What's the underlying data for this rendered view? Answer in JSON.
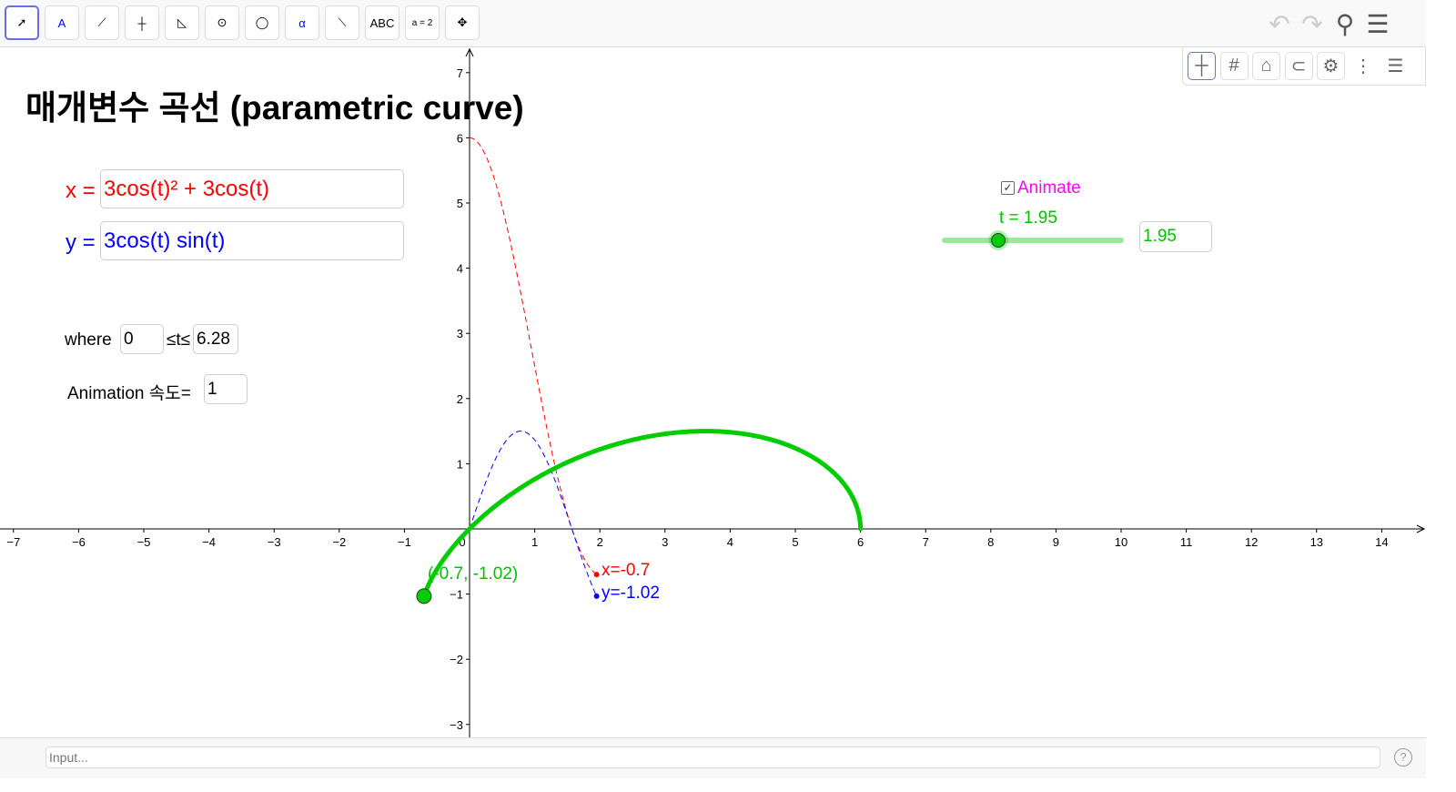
{
  "toolbar": {
    "tools": [
      {
        "name": "move-tool",
        "label": ""
      },
      {
        "name": "point-tool",
        "label": "A"
      },
      {
        "name": "line-tool",
        "label": ""
      },
      {
        "name": "perpendicular-line-tool",
        "label": ""
      },
      {
        "name": "polygon-tool",
        "label": ""
      },
      {
        "name": "circle-center-point-tool",
        "label": ""
      },
      {
        "name": "circle-three-points-tool",
        "label": ""
      },
      {
        "name": "angle-tool",
        "label": "α"
      },
      {
        "name": "reflect-tool",
        "label": ""
      },
      {
        "name": "text-tool",
        "label": "ABC"
      },
      {
        "name": "slider-tool",
        "label": "a = 2"
      },
      {
        "name": "move-graphics-tool",
        "label": ""
      }
    ],
    "right_icons": [
      "undo-icon",
      "redo-icon",
      "search-icon",
      "menu-icon"
    ]
  },
  "graphics_bar": {
    "icons": [
      "axes-icon",
      "grid-icon",
      "home-icon",
      "magnet-icon",
      "gear-icon",
      "more-icon",
      "style-bar-icon"
    ]
  },
  "title": "매개변수 곡선 (parametric curve)",
  "equations": {
    "x_label": "x =",
    "x_value": "3cos(t)² + 3cos(t)",
    "y_label": "y =",
    "y_value": "3cos(t) sin(t)"
  },
  "range": {
    "where_label": "where",
    "min": "0",
    "symbol": "≤t≤",
    "max": "6.28"
  },
  "animation": {
    "label": "Animation 속도=",
    "speed": "1"
  },
  "animate_checkbox": {
    "label": "Animate",
    "checked": true
  },
  "slider": {
    "label": "t = 1.95",
    "value": 1.95,
    "min": 0,
    "max": 6.28,
    "input_value": "1.95"
  },
  "point_label": "(-0.7, -1.02)",
  "x_point_label": "x=-0.7",
  "y_point_label": "y=-1.02",
  "input_bar": {
    "placeholder": "Input..."
  },
  "colors": {
    "x": "#ff0000",
    "y": "#0000ff",
    "curve": "#00cc00",
    "animate": "#ff00ff"
  },
  "axes": {
    "x_ticks": [
      -7,
      -6,
      -5,
      -4,
      -3,
      -2,
      -1,
      0,
      1,
      2,
      3,
      4,
      5,
      6,
      7,
      8,
      9,
      10,
      11,
      12,
      13,
      14
    ],
    "y_ticks": [
      -3,
      -2,
      -1,
      1,
      2,
      3,
      4,
      5,
      6,
      7
    ]
  }
}
